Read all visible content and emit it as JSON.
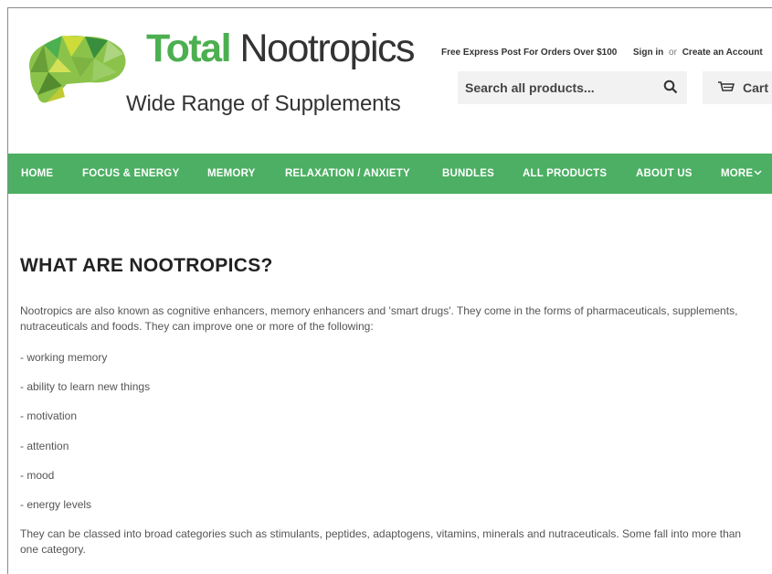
{
  "brand": {
    "name_part1": "Total",
    "name_part2": "Nootropics",
    "tagline": "Wide Range of Supplements"
  },
  "topbar": {
    "promo": "Free Express Post For Orders Over $100",
    "sign_in": "Sign in",
    "or": "or",
    "create_account": "Create an Account"
  },
  "search": {
    "placeholder": "Search all products..."
  },
  "cart": {
    "label": "Cart"
  },
  "nav": {
    "items": [
      "HOME",
      "FOCUS & ENERGY",
      "MEMORY",
      "RELAXATION / ANXIETY",
      "BUNDLES",
      "ALL PRODUCTS",
      "ABOUT US",
      "MORE"
    ]
  },
  "article": {
    "title": "WHAT ARE NOOTROPICS?",
    "intro_line1": "Nootropics are also known as cognitive enhancers, memory enhancers and 'smart drugs'. They come in the forms of pharmaceuticals, supplements,",
    "intro_line2": "nutraceuticals and foods. They can improve one or more of the following:",
    "list": [
      "- working memory",
      "- ability to learn new things",
      "- motivation",
      "- attention",
      "- mood",
      "- energy levels"
    ],
    "outro_line1": "They can be classed into broad categories such as stimulants, peptides, adaptogens, vitamins, minerals and nutraceuticals. Some fall into more than",
    "outro_line2": "one category."
  },
  "colors": {
    "brand_green": "#4caf50",
    "nav_green": "#4caf63"
  }
}
